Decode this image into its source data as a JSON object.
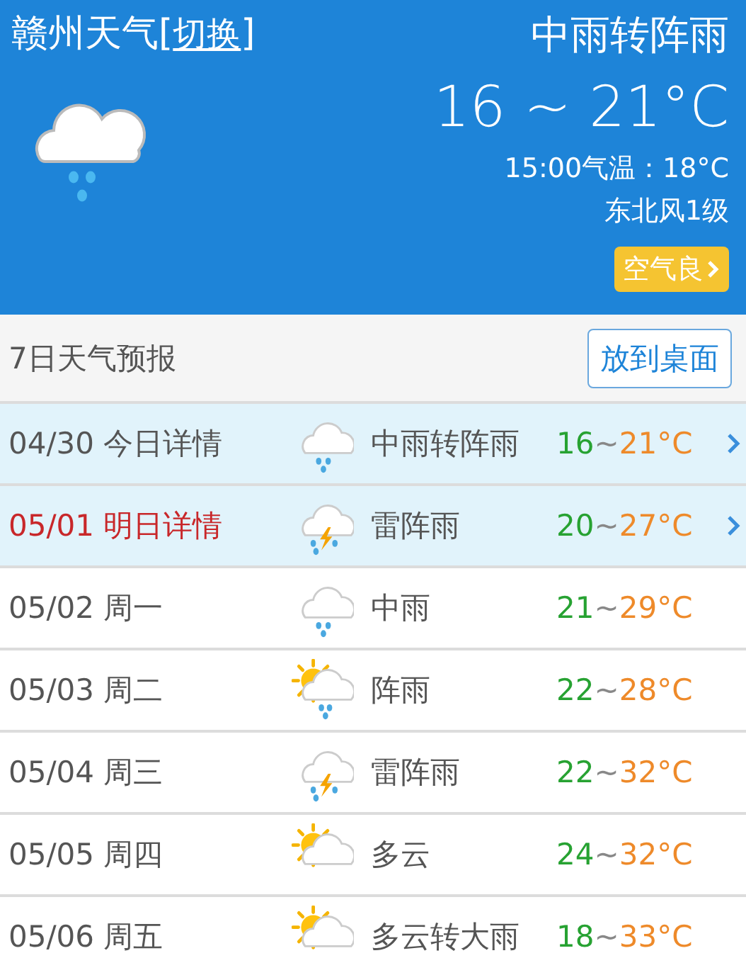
{
  "header": {
    "city": "赣州天气",
    "bracket_open": "[",
    "switch_link": "切换",
    "bracket_close": "]",
    "condition": "中雨转阵雨",
    "temperature": "16 ~ 21°C",
    "current": "15:00气温：18°C",
    "wind": "东北风1级",
    "air_quality": "空气良",
    "kind": "rain"
  },
  "forecast": {
    "title": "7日天气预报",
    "desktop_button": "放到桌面",
    "days": [
      {
        "date": "04/30",
        "label": "今日详情",
        "kind": "rain",
        "condition": "中雨转阵雨",
        "low": "16",
        "separator": "~",
        "high": "21°C",
        "expandable": true,
        "emphasis": false
      },
      {
        "date": "05/01",
        "label": "明日详情",
        "kind": "thunder",
        "condition": "雷阵雨",
        "low": "20",
        "separator": "~",
        "high": "27°C",
        "expandable": true,
        "emphasis": true
      },
      {
        "date": "05/02",
        "label": "周一",
        "kind": "rain",
        "condition": "中雨",
        "low": "21",
        "separator": "~",
        "high": "29°C",
        "expandable": false,
        "emphasis": false
      },
      {
        "date": "05/03",
        "label": "周二",
        "kind": "sun-rain",
        "condition": "阵雨",
        "low": "22",
        "separator": "~",
        "high": "28°C",
        "expandable": false,
        "emphasis": false
      },
      {
        "date": "05/04",
        "label": "周三",
        "kind": "thunder",
        "condition": "雷阵雨",
        "low": "22",
        "separator": "~",
        "high": "32°C",
        "expandable": false,
        "emphasis": false
      },
      {
        "date": "05/05",
        "label": "周四",
        "kind": "sun-cloud",
        "condition": "多云",
        "low": "24",
        "separator": "~",
        "high": "32°C",
        "expandable": false,
        "emphasis": false
      },
      {
        "date": "05/06",
        "label": "周五",
        "kind": "sun-cloud",
        "condition": "多云转大雨",
        "low": "18",
        "separator": "~",
        "high": "33°C",
        "expandable": false,
        "emphasis": false
      }
    ]
  }
}
